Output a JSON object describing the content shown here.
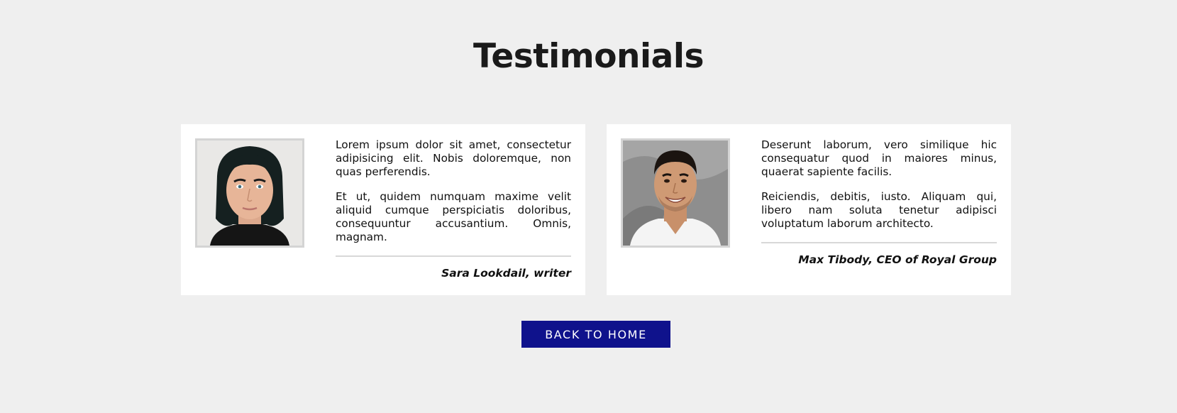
{
  "page": {
    "title": "Testimonials"
  },
  "testimonials": [
    {
      "photo_icon": "woman-portrait-photo",
      "paragraphs": [
        "Lorem ipsum dolor sit amet, consectetur adipisicing elit. Nobis doloremque, non quas perferendis.",
        "Et ut, quidem numquam maxime velit aliquid cumque perspiciatis doloribus, consequuntur accusantium. Omnis, magnam."
      ],
      "author": "Sara Lookdail, writer"
    },
    {
      "photo_icon": "man-portrait-photo",
      "paragraphs": [
        "Deserunt laborum, vero similique hic consequatur quod in maiores minus, quaerat sapiente facilis.",
        "Reiciendis, debitis, iusto. Aliquam qui, libero nam soluta tenetur adipisci voluptatum laborum architecto."
      ],
      "author": "Max Tibody, CEO of Royal Group"
    }
  ],
  "back_button": {
    "label": "BACK TO HOME"
  },
  "colors": {
    "background": "#efefef",
    "card": "#ffffff",
    "button": "#0f128c",
    "button_text": "#ffffff",
    "photo_border": "#d4d4d4"
  }
}
